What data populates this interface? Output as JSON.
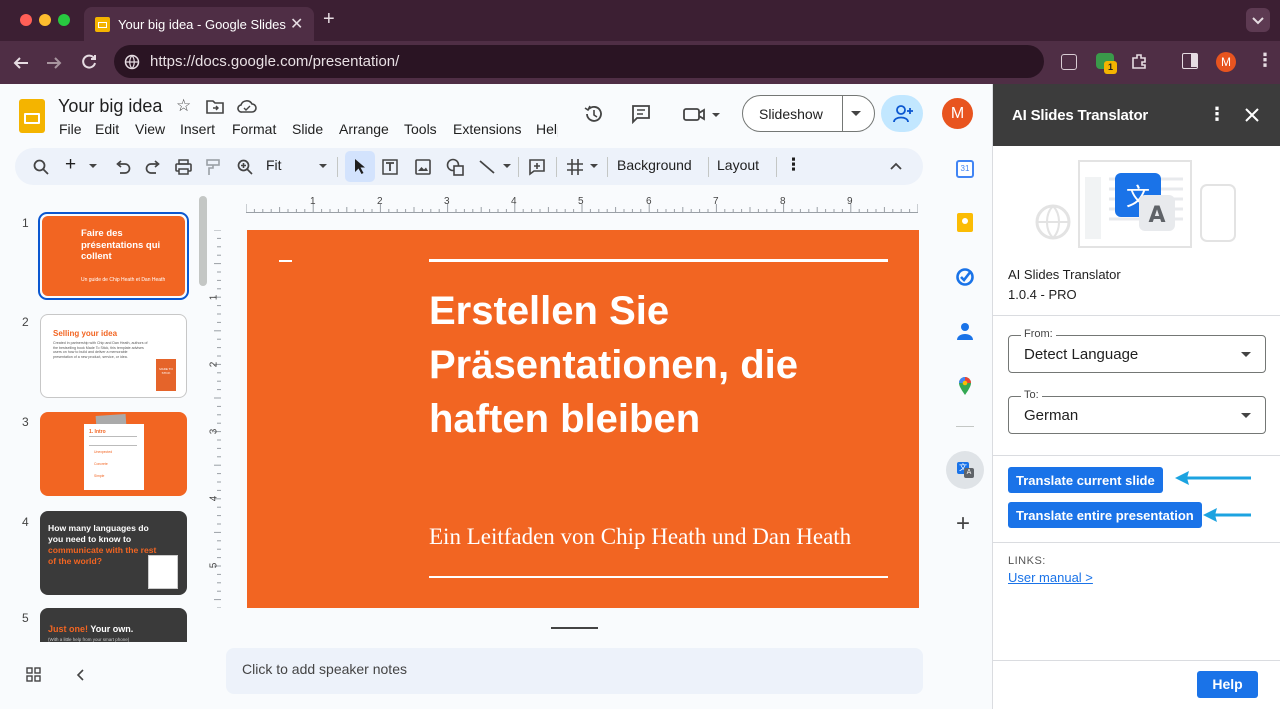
{
  "browser": {
    "tab_title": "Your big idea - Google Slides",
    "url": "https://docs.google.com/presentation/",
    "profile_initial": "M",
    "extension_badge": "1"
  },
  "docs": {
    "title": "Your big idea",
    "menu": [
      "File",
      "Edit",
      "View",
      "Insert",
      "Format",
      "Slide",
      "Arrange",
      "Tools",
      "Extensions",
      "Help"
    ],
    "slideshow_label": "Slideshow",
    "avatar_initial": "M",
    "toolbar": {
      "zoom": "Fit",
      "background_label": "Background",
      "layout_label": "Layout"
    },
    "ruler_h": [
      "1",
      "2",
      "3",
      "4",
      "5",
      "6",
      "7",
      "8",
      "9"
    ],
    "ruler_v": [
      "1",
      "2",
      "3",
      "4",
      "5"
    ],
    "speaker_notes_placeholder": "Click to add speaker notes"
  },
  "slides": [
    {
      "num": "1",
      "title": "Faire des présentations qui collent",
      "subtitle": "Un guide de Chip Heath et Dan Heath"
    },
    {
      "num": "2",
      "title": "Selling your idea",
      "body": "Created in partnership with Chip and Dan Heath, authors of the bestselling book Made To Stick, this template advises users on how to build and deliver a memorable presentation of a new product, service, or idea.",
      "book": "MADE TO STICK"
    },
    {
      "num": "3",
      "title": "1. Intro",
      "items": [
        "Unexpected",
        "Concrete",
        "Simple"
      ]
    },
    {
      "num": "4",
      "title_a": "How many languages do you need to know to",
      "title_b": "communicate with the rest of the world?"
    },
    {
      "num": "5",
      "title_a": "Just one!",
      "title_b": "Your own.",
      "body": "(With a little help from your smart phone)"
    }
  ],
  "current_slide": {
    "title": "Erstellen Sie Präsentationen, die haften bleiben",
    "subtitle": "Ein Leitfaden von Chip Heath und Dan Heath"
  },
  "addon": {
    "header": "AI Slides Translator",
    "name": "AI Slides Translator",
    "version": "1.0.4 - PRO",
    "from_caption": "From:",
    "from_value": "Detect Language",
    "to_caption": "To:",
    "to_value": "German",
    "translate_slide": "Translate current slide",
    "translate_all": "Translate entire presentation",
    "links_caption": "LINKS:",
    "user_manual": "User manual >",
    "help": "Help"
  },
  "colors": {
    "slide_orange": "#f26522",
    "accent_blue": "#1a73e8",
    "arrow_cyan": "#1ca3e0",
    "chrome_bg": "#3c1f33"
  }
}
